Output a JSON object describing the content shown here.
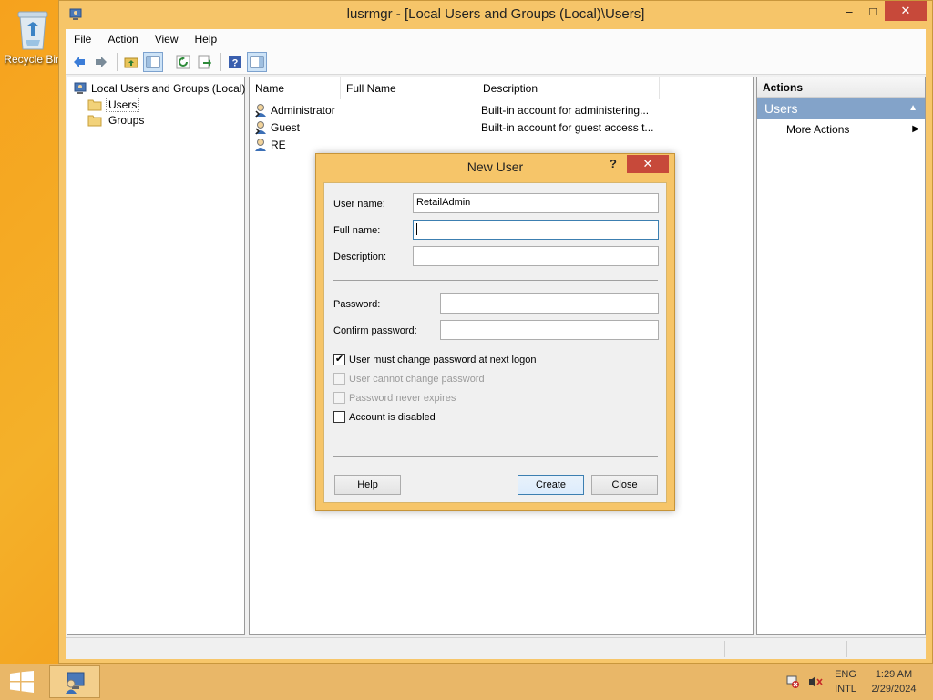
{
  "desktop": {
    "recycle_bin_label": "Recycle Bin"
  },
  "window": {
    "title": "lusrmgr - [Local Users and Groups (Local)\\Users]",
    "controls": {
      "minimize": "–",
      "maximize": "□",
      "close": "✕"
    }
  },
  "menu": {
    "file": "File",
    "action": "Action",
    "view": "View",
    "help": "Help"
  },
  "toolbar": {
    "buttons": [
      "back-icon",
      "forward-icon",
      "up-folder-icon",
      "show-hide-tree-icon",
      "refresh-icon",
      "export-list-icon",
      "help-icon",
      "show-hide-action-pane-icon"
    ]
  },
  "tree": {
    "root": "Local Users and Groups (Local)",
    "items": [
      {
        "label": "Users",
        "selected": true
      },
      {
        "label": "Groups",
        "selected": false
      }
    ]
  },
  "list": {
    "columns": [
      "Name",
      "Full Name",
      "Description"
    ],
    "rows": [
      {
        "name": "Administrator",
        "full_name": "",
        "description": "Built-in account for administering..."
      },
      {
        "name": "Guest",
        "full_name": "",
        "description": "Built-in account for guest access t..."
      },
      {
        "name": "RE",
        "full_name": "",
        "description": ""
      }
    ]
  },
  "actions": {
    "title": "Actions",
    "group": "Users",
    "items": [
      {
        "label": "More Actions"
      }
    ]
  },
  "dialog": {
    "title": "New User",
    "help_glyph": "?",
    "close_glyph": "✕",
    "username_label": "User name:",
    "username_value": "RetailAdmin",
    "fullname_label": "Full name:",
    "fullname_value": "",
    "description_label": "Description:",
    "description_value": "",
    "password_label": "Password:",
    "confirm_password_label": "Confirm password:",
    "checkboxes": [
      {
        "label": "User must change password at next logon",
        "checked": true,
        "enabled": true
      },
      {
        "label": "User cannot change password",
        "checked": false,
        "enabled": false
      },
      {
        "label": "Password never expires",
        "checked": false,
        "enabled": false
      },
      {
        "label": "Account is disabled",
        "checked": false,
        "enabled": true
      }
    ],
    "buttons": {
      "help": "Help",
      "create": "Create",
      "close": "Close"
    }
  },
  "taskbar": {
    "language_line1": "ENG",
    "language_line2": "INTL",
    "time": "1:29 AM",
    "date": "2/29/2024"
  },
  "colors": {
    "accent": "#f6c569",
    "close_red": "#c7493a",
    "actions_group_bg": "#83a3c9",
    "focus_border": "#3c7fb1"
  }
}
